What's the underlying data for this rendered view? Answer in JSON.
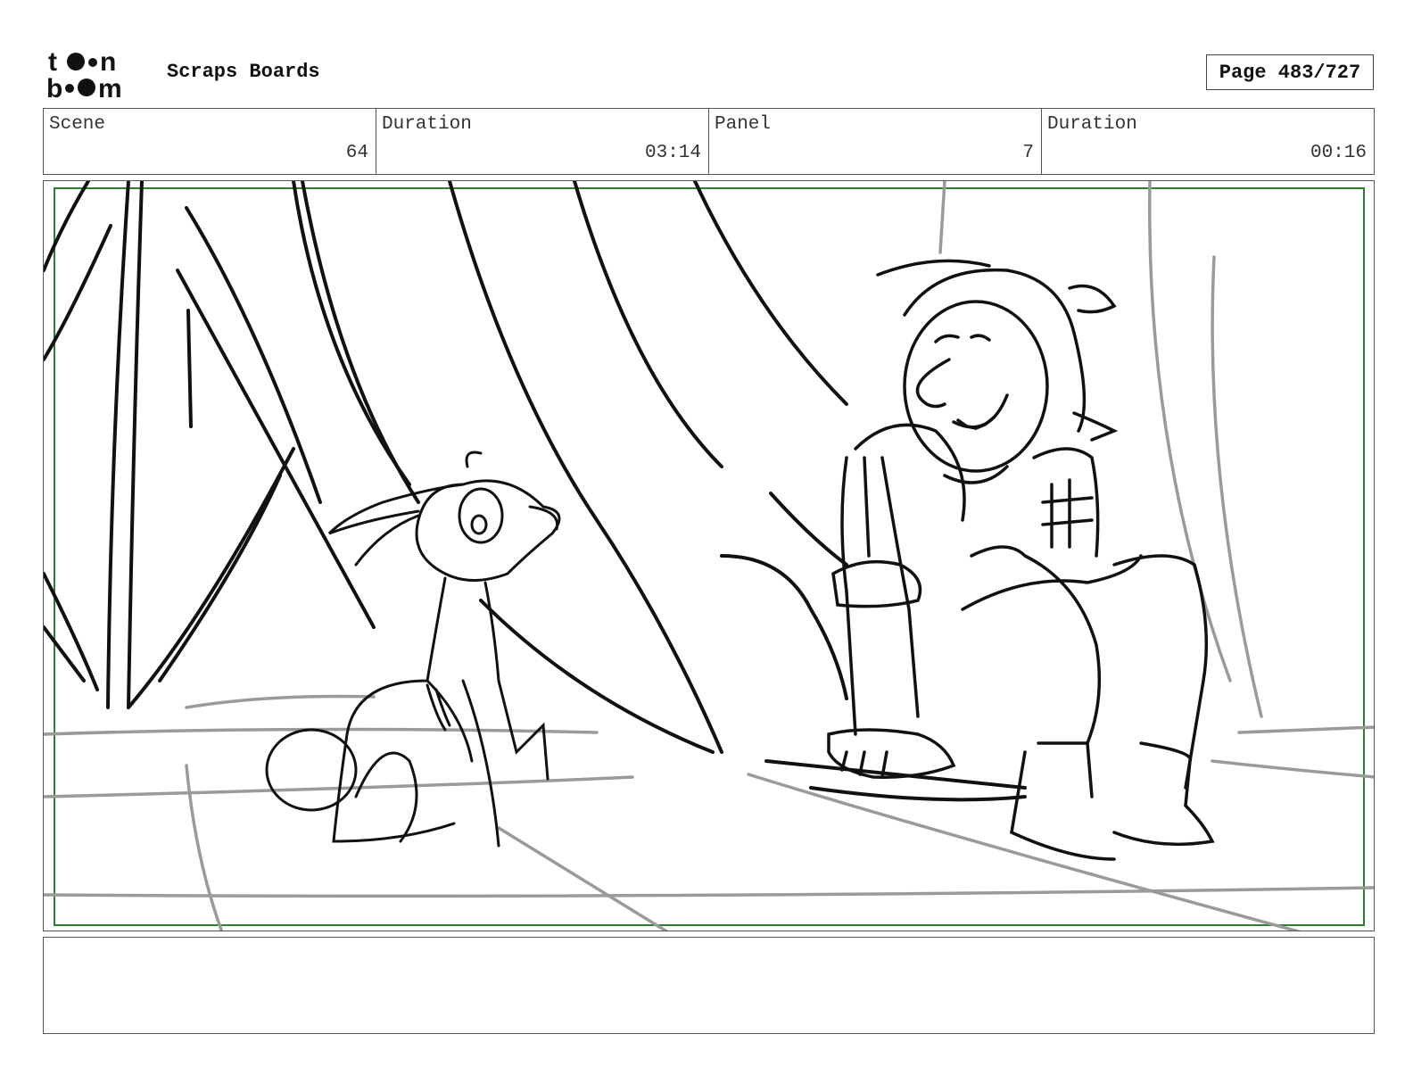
{
  "header": {
    "logo_text_top": "toon",
    "logo_text_bottom": "boom",
    "title": "Scraps Boards",
    "page_label": "Page 483/727"
  },
  "info": {
    "scene_label": "Scene",
    "scene_value": "64",
    "scene_duration_label": "Duration",
    "scene_duration_value": "03:14",
    "panel_label": "Panel",
    "panel_value": "7",
    "panel_duration_label": "Duration",
    "panel_duration_value": "00:16"
  },
  "notes": {
    "text": ""
  },
  "colors": {
    "safe_area_border": "#2e7d32",
    "sketch_line": "#111111",
    "sketch_background": "#9a9a9a"
  }
}
